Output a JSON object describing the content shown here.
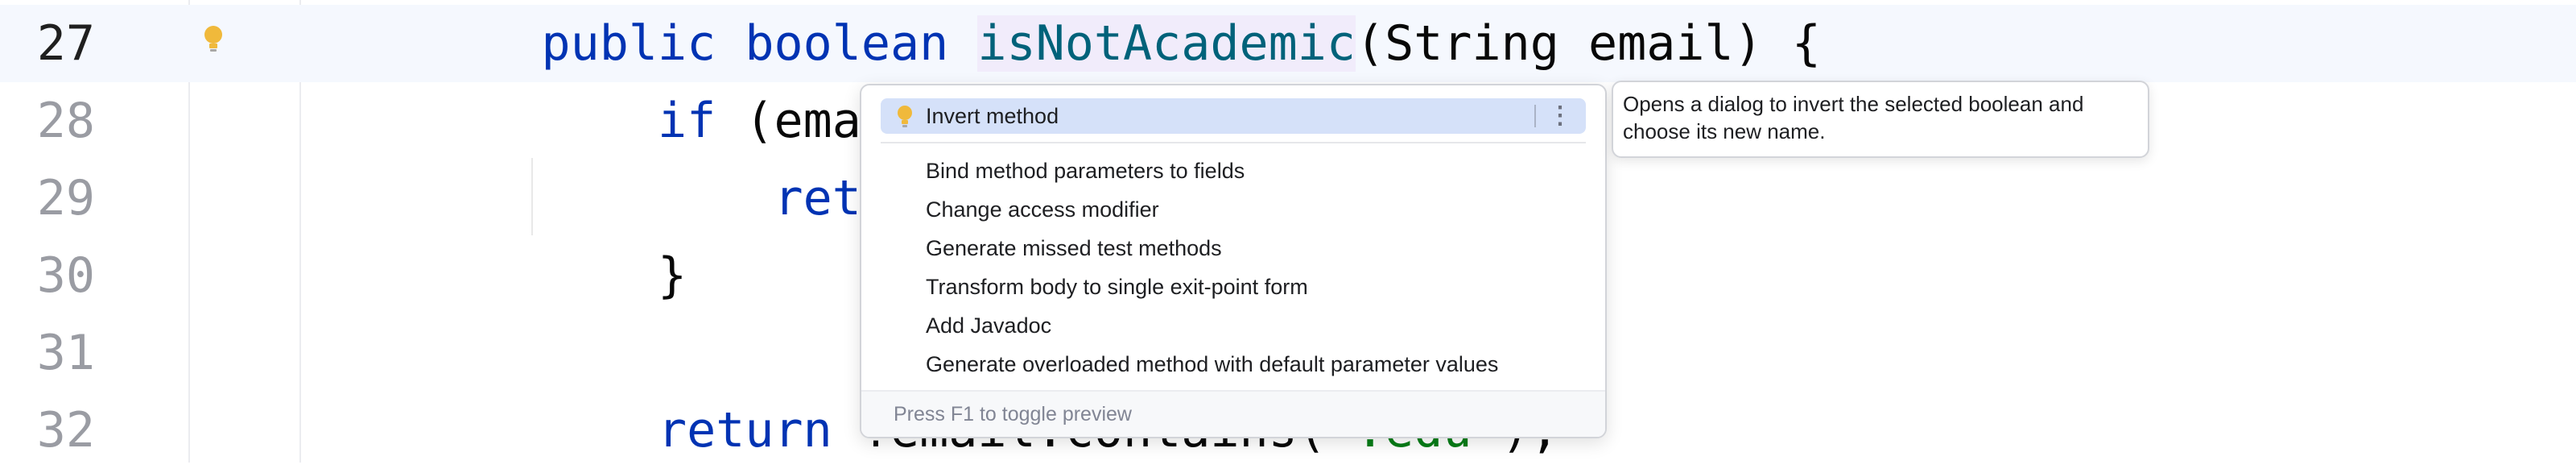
{
  "editor": {
    "current_line": 27,
    "lines": [
      {
        "number": "27",
        "parts": [
          {
            "cls": "indent",
            "text": "    "
          },
          {
            "cls": "kw",
            "text": "public boolean "
          },
          {
            "cls": "fn ident-hl",
            "text": "isNotAcademic"
          },
          {
            "cls": "plain",
            "text": "(String email) {"
          }
        ]
      },
      {
        "number": "28",
        "parts": [
          {
            "cls": "indent",
            "text": "        "
          },
          {
            "cls": "kw",
            "text": "if "
          },
          {
            "cls": "plain",
            "text": "(email ="
          }
        ]
      },
      {
        "number": "29",
        "parts": [
          {
            "cls": "indent",
            "text": "            "
          },
          {
            "cls": "kw",
            "text": "return"
          }
        ]
      },
      {
        "number": "30",
        "parts": [
          {
            "cls": "indent",
            "text": "        "
          },
          {
            "cls": "plain",
            "text": "}"
          }
        ]
      },
      {
        "number": "31",
        "parts": []
      },
      {
        "number": "32",
        "parts": [
          {
            "cls": "indent",
            "text": "        "
          },
          {
            "cls": "kw",
            "text": "return "
          },
          {
            "cls": "plain",
            "text": "!email.contains("
          },
          {
            "cls": "str",
            "text": "\".edu\""
          },
          {
            "cls": "plain",
            "text": ");"
          }
        ]
      }
    ]
  },
  "intention_popup": {
    "selected_item": "Invert method",
    "items": [
      "Bind method parameters to fields",
      "Change access modifier",
      "Generate missed test methods",
      "Transform body to single exit-point form",
      "Add Javadoc",
      "Generate overloaded method with default parameter values"
    ],
    "more_icon": "⋮",
    "footer": "Press F1 to toggle preview"
  },
  "tooltip": {
    "text": "Opens a dialog to invert the selected boolean and choose its new name."
  },
  "colors": {
    "keyword": "#0033b3",
    "method": "#00627a",
    "string": "#067d17",
    "selection": "#d5e1f9",
    "bulb": "#f0b93b"
  }
}
